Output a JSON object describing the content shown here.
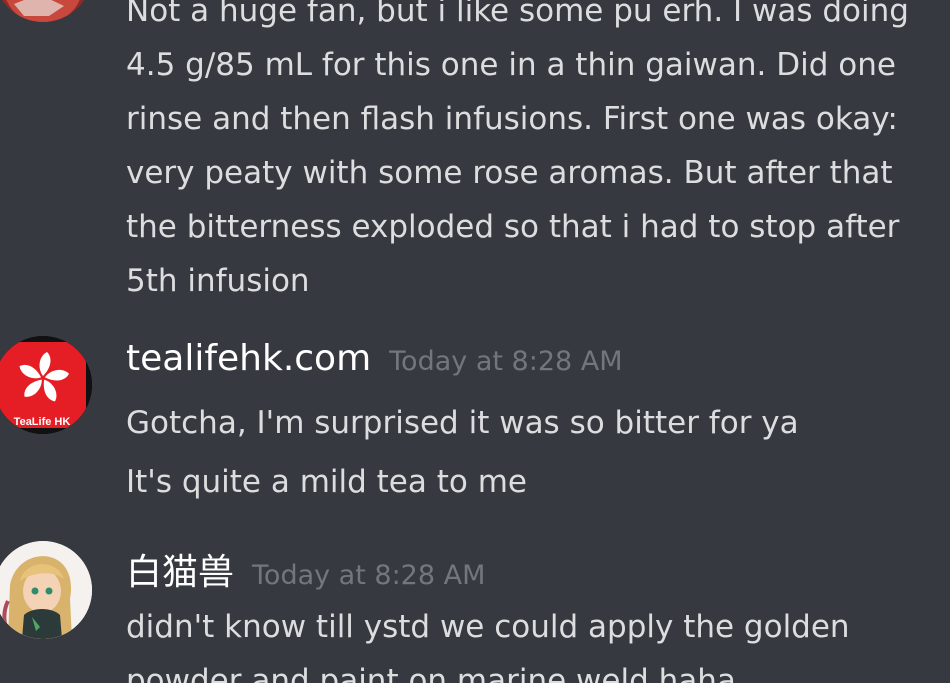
{
  "messages": [
    {
      "id": "prev",
      "lines": [
        "Not a huge fan, but i like some pu erh. I was doing",
        "4.5 g/85 mL for this one in a thin gaiwan. Did one",
        "rinse and then flash infusions. First one was okay:",
        "very peaty with some rose aromas. But after that",
        "the bitterness exploded so that i had to stop after",
        "5th infusion"
      ]
    },
    {
      "id": "tealife",
      "author": "tealifehk.com",
      "timestamp": "Today at 8:28 AM",
      "avatar_label": "TeaLife HK",
      "lines": [
        "Gotcha, I'm surprised it was so bitter for ya",
        "It's quite a mild tea to me"
      ]
    },
    {
      "id": "baimao",
      "author": "白猫兽",
      "timestamp": "Today at 8:28 AM",
      "lines": [
        "didn't know till ystd we could apply the golden",
        "powder and paint on marine weld haha"
      ]
    }
  ],
  "colors": {
    "background": "#36393f",
    "text": "#dcddde",
    "username": "#ffffff",
    "timestamp": "#72767d",
    "tealife_red": "#e51e25"
  }
}
